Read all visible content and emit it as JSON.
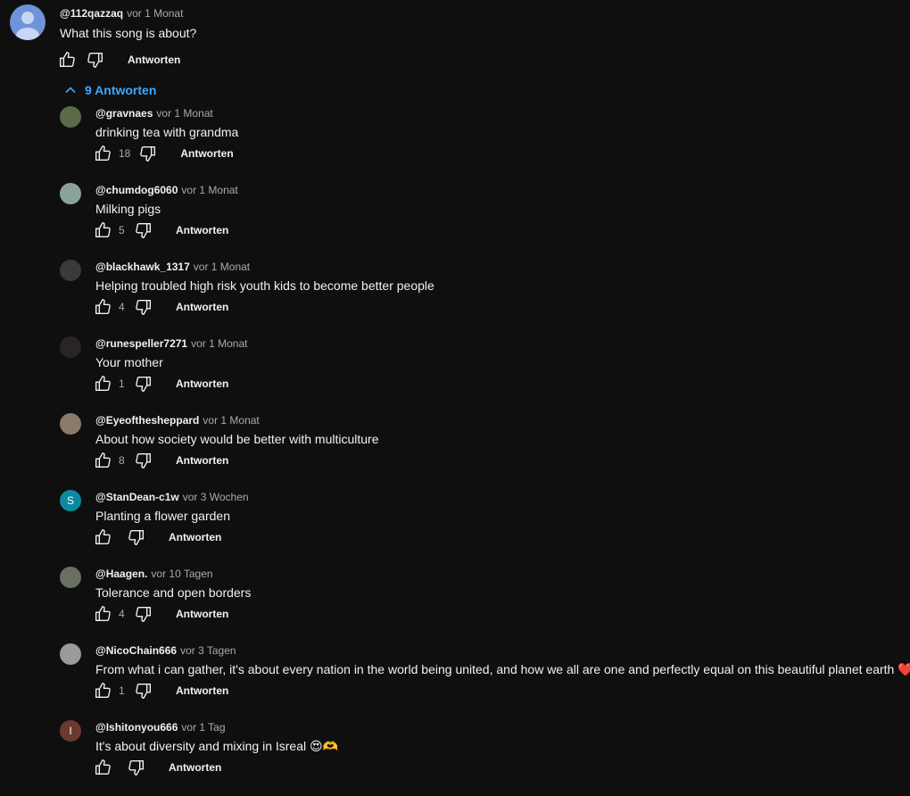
{
  "top_comment": {
    "author": "@112qazzaq",
    "time": "vor 1 Monat",
    "text": "What this song is about?",
    "reply_label": "Antworten"
  },
  "replies_toggle": {
    "label": "9 Antworten"
  },
  "replies": [
    {
      "author": "@gravnaes",
      "time": "vor 1 Monat",
      "text": "drinking tea with grandma",
      "likes": "18",
      "reply_label": "Antworten",
      "avatar_color": "#5a6b4a"
    },
    {
      "author": "@chumdog6060",
      "time": "vor 1 Monat",
      "text": "Milking pigs",
      "likes": "5",
      "reply_label": "Antworten",
      "avatar_color": "#8aa39a"
    },
    {
      "author": "@blackhawk_1317",
      "time": "vor 1 Monat",
      "text": "Helping troubled high risk youth kids to become better people",
      "likes": "4",
      "reply_label": "Antworten",
      "avatar_color": "#3a3a3a"
    },
    {
      "author": "@runespeller7271",
      "time": "vor 1 Monat",
      "text": "Your mother",
      "likes": "1",
      "reply_label": "Antworten",
      "avatar_color": "#2a2424"
    },
    {
      "author": "@Eyeofthesheppard",
      "time": "vor 1 Monat",
      "text": "About how society would be better with multiculture",
      "likes": "8",
      "reply_label": "Antworten",
      "avatar_color": "#8a7a6a"
    },
    {
      "author": "@StanDean-c1w",
      "time": "vor 3 Wochen",
      "text": "Planting a flower garden",
      "likes": "",
      "reply_label": "Antworten",
      "avatar_color": "#0a8a9e",
      "avatar_letter": "S"
    },
    {
      "author": "@Haagen.",
      "time": "vor 10 Tagen",
      "text": "Tolerance and open borders",
      "likes": "4",
      "reply_label": "Antworten",
      "avatar_color": "#6a7060"
    },
    {
      "author": "@NicoChain666",
      "time": "vor 3 Tagen",
      "text": "From what i can gather, it's about every nation in the world being united, and how we all are one and perfectly equal on this beautiful planet earth ❤️",
      "likes": "1",
      "reply_label": "Antworten",
      "avatar_color": "#9a9a9a"
    },
    {
      "author": "@Ishitonyou666",
      "time": "vor 1 Tag",
      "text": "It's about diversity and mixing in Isreal 😍🫶",
      "likes": "",
      "reply_label": "Antworten",
      "avatar_color": "#6b3a2e",
      "avatar_letter": "I"
    }
  ]
}
